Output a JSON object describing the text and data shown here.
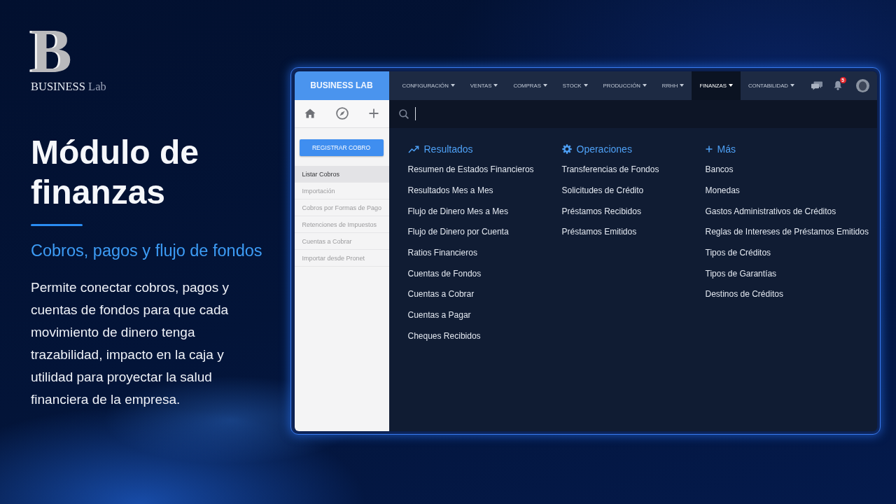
{
  "logo": {
    "mark": "B",
    "name": "BUSINESS",
    "suffix": "Lab"
  },
  "hero": {
    "title": "Módulo de finanzas",
    "subtitle": "Cobros, pagos y flujo de fondos",
    "body": "Permite conectar cobros, pagos y cuentas de fondos para que cada movimiento de dinero tenga trazabilidad, impacto en la caja y utilidad para proyectar la salud financiera de la empresa."
  },
  "app": {
    "brand": "BUSINESS LAB",
    "nav": [
      {
        "label": "CONFIGURACIÓN",
        "selected": false
      },
      {
        "label": "VENTAS",
        "selected": false
      },
      {
        "label": "COMPRAS",
        "selected": false
      },
      {
        "label": "STOCK",
        "selected": false
      },
      {
        "label": "PRODUCCIÓN",
        "selected": false
      },
      {
        "label": "RRHH",
        "selected": false
      },
      {
        "label": "FINANZAS",
        "selected": true
      },
      {
        "label": "CONTABILIDAD",
        "selected": false
      }
    ],
    "notifications": {
      "count": "5"
    },
    "search": {
      "focused": true
    },
    "sidebar": {
      "button": "REGISTRAR COBRO",
      "items": [
        {
          "label": "Listar Cobros",
          "selected": true
        },
        {
          "label": "Importación",
          "selected": false
        },
        {
          "label": "Cobros por Formas de Pago",
          "selected": false
        },
        {
          "label": "Retenciones de Impuestos",
          "selected": false
        },
        {
          "label": "Cuentas a Cobrar",
          "selected": false
        },
        {
          "label": "Importar desde Pronet",
          "selected": false
        }
      ]
    },
    "menu": [
      {
        "kind": "chart",
        "heading": "Resultados",
        "items": [
          "Resumen de Estados Financieros",
          "Resultados Mes a Mes",
          "Flujo de Dinero Mes a Mes",
          "Flujo de Dinero por Cuenta",
          "Ratios Financieros",
          "Cuentas de Fondos",
          "Cuentas a Cobrar",
          "Cuentas a Pagar",
          "Cheques Recibidos"
        ]
      },
      {
        "kind": "settings",
        "heading": "Operaciones",
        "items": [
          "Transferencias de Fondos",
          "Solicitudes de Crédito",
          "Préstamos Recibidos",
          "Préstamos Emitidos"
        ]
      },
      {
        "kind": "add",
        "heading": "Más",
        "items": [
          "Bancos",
          "Monedas",
          "Gastos Administrativos de Créditos",
          "Reglas de Intereses de Préstamos Emitidos",
          "Tipos de Créditos",
          "Tipos de Garantías",
          "Destinos de Créditos"
        ]
      }
    ]
  }
}
